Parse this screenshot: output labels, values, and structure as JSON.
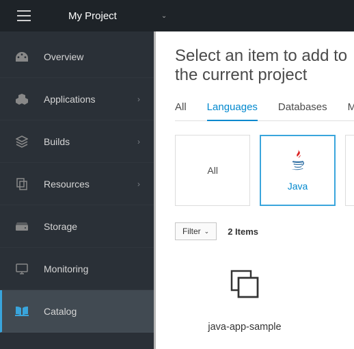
{
  "header": {
    "project_name": "My Project"
  },
  "sidebar": {
    "items": [
      {
        "label": "Overview",
        "expandable": false
      },
      {
        "label": "Applications",
        "expandable": true
      },
      {
        "label": "Builds",
        "expandable": true
      },
      {
        "label": "Resources",
        "expandable": true
      },
      {
        "label": "Storage",
        "expandable": false
      },
      {
        "label": "Monitoring",
        "expandable": false
      },
      {
        "label": "Catalog",
        "expandable": false
      }
    ],
    "active_index": 6
  },
  "content": {
    "title": "Select an item to add to the current project",
    "tabs": [
      {
        "label": "All"
      },
      {
        "label": "Languages"
      },
      {
        "label": "Databases"
      },
      {
        "label": "Middleware"
      }
    ],
    "active_tab": 1,
    "category_cards": [
      {
        "label": "All"
      },
      {
        "label": "Java"
      }
    ],
    "selected_card": 1,
    "filter_label": "Filter",
    "items_count_text": "2 Items",
    "items": [
      {
        "name": "java-app-sample"
      }
    ]
  }
}
